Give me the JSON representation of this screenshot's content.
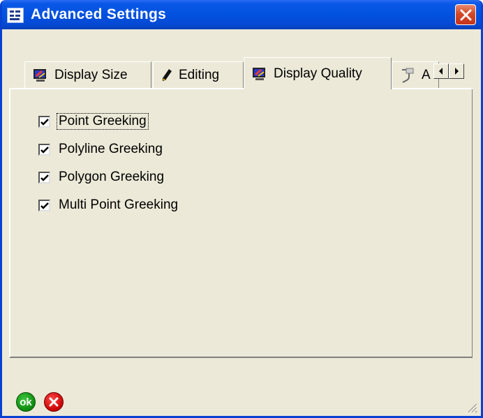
{
  "window": {
    "title": "Advanced Settings"
  },
  "tabs": [
    {
      "label": "Display Size",
      "icon": "monitor-paint-icon",
      "active": false
    },
    {
      "label": "Editing",
      "icon": "pencil-icon",
      "active": false
    },
    {
      "label": "Display Quality",
      "icon": "monitor-paint-icon",
      "active": true
    },
    {
      "label": "A",
      "icon": "plug-icon",
      "active": false
    }
  ],
  "options": [
    {
      "label": "Point Greeking",
      "checked": true
    },
    {
      "label": "Polyline Greeking",
      "checked": true
    },
    {
      "label": "Polygon Greeking",
      "checked": true
    },
    {
      "label": "Multi Point Greeking",
      "checked": true
    }
  ],
  "footer": {
    "ok_label": "ok"
  },
  "colors": {
    "titlebar": "#0252e0",
    "window_bg": "#ece9d8",
    "ok": "#0c8a0c",
    "cancel": "#c80000",
    "close": "#d34a28"
  }
}
